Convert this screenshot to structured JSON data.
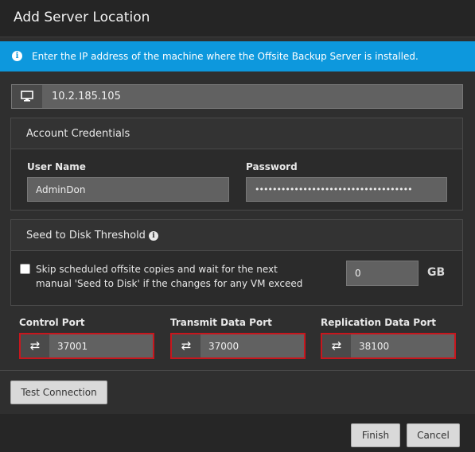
{
  "dialog": {
    "title": "Add Server Location"
  },
  "info_banner": {
    "icon": "info-icon",
    "text": "Enter the IP address of the machine where the Offsite Backup Server is installed."
  },
  "server_address": {
    "icon": "monitor-icon",
    "value": "10.2.185.105"
  },
  "credentials": {
    "title": "Account Credentials",
    "username_label": "User Name",
    "username_value": "AdminDon",
    "password_label": "Password",
    "password_value": "••••••••••••••••••••••••••••••••••••"
  },
  "seed": {
    "title": "Seed to Disk Threshold",
    "checkbox_checked": false,
    "checkbox_label_line1": "Skip scheduled offsite copies and wait for the next",
    "checkbox_label_line2": "manual 'Seed to Disk' if the changes for any VM exceed",
    "threshold_value": "0",
    "unit": "GB"
  },
  "ports": [
    {
      "label": "Control Port",
      "value": "37001",
      "icon": "swap-arrows-icon"
    },
    {
      "label": "Transmit Data Port",
      "value": "37000",
      "icon": "swap-arrows-icon"
    },
    {
      "label": "Replication Data Port",
      "value": "38100",
      "icon": "swap-arrows-icon"
    }
  ],
  "buttons": {
    "test_connection": "Test Connection",
    "finish": "Finish",
    "cancel": "Cancel"
  },
  "colors": {
    "info_banner": "#0d98dd",
    "error_border": "#c8161d"
  }
}
